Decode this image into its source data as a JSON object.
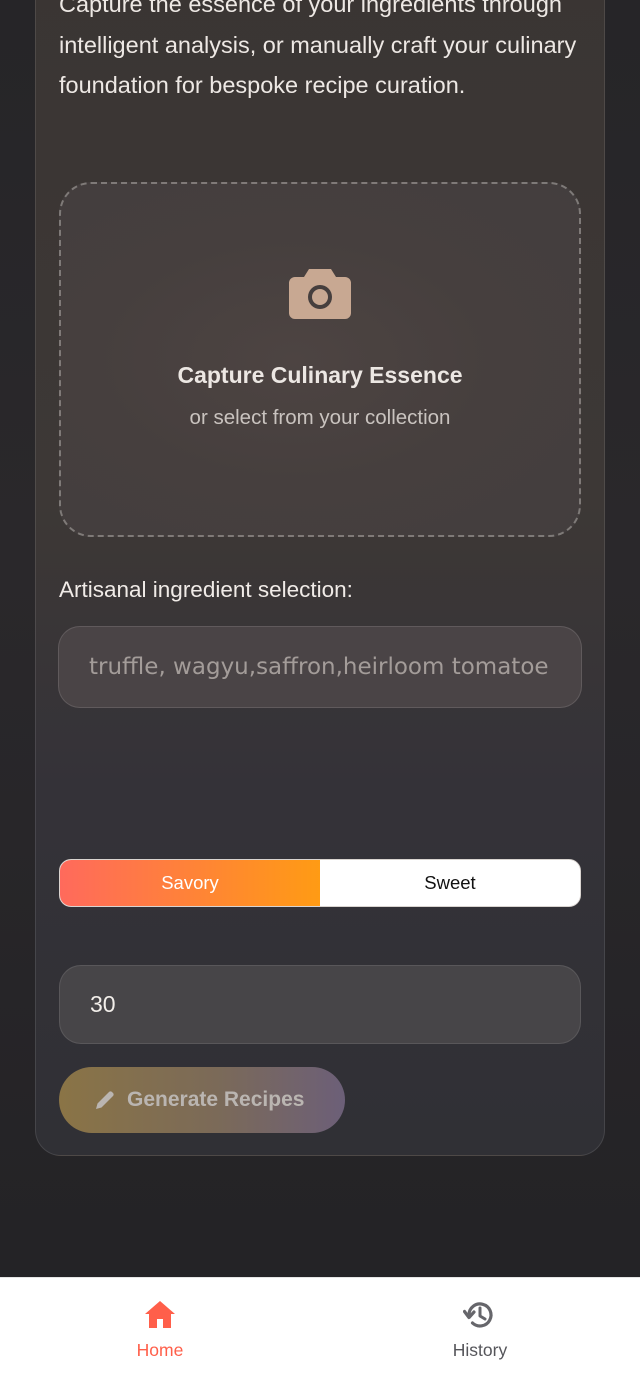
{
  "intro": {
    "text": "Capture the essence of your ingredients through intelligent analysis, or manually craft your culinary foundation for bespoke recipe curation."
  },
  "upload": {
    "icon": "camera-icon",
    "title": "Capture Culinary Essence",
    "subtitle": "or select from your collection"
  },
  "ingredients": {
    "label": "Artisanal ingredient selection:",
    "value": "",
    "placeholder": "truffle, wagyu,saffron,heirloom tomatoe"
  },
  "flavor_toggle": {
    "options": [
      "Savory",
      "Sweet"
    ],
    "selected": "Savory",
    "active_gradient": [
      "#ff6a5c",
      "#ff9b14"
    ]
  },
  "time_input": {
    "value": "30"
  },
  "generate_button": {
    "icon": "pencil-icon",
    "label": "Generate Recipes"
  },
  "tabbar": {
    "items": [
      {
        "label": "Home",
        "icon": "home-icon",
        "active": true
      },
      {
        "label": "History",
        "icon": "history-icon",
        "active": false
      }
    ],
    "accent": "#ff5f4a"
  }
}
